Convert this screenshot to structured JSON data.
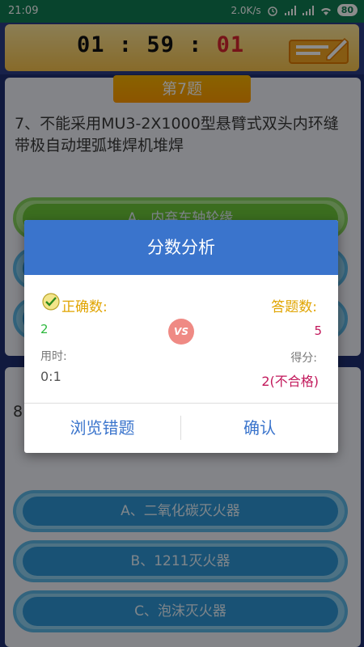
{
  "status_bar": {
    "time": "21:09",
    "speed": "2.0K/s",
    "battery": "80",
    "icons": [
      "alarm-icon",
      "signal-icon",
      "signal-icon",
      "wifi-icon",
      "battery-icon"
    ]
  },
  "timer": {
    "hours": "01",
    "sep1": ":",
    "minutes": "59",
    "sep2": ":",
    "seconds": "01"
  },
  "question1": {
    "tab": "第7题",
    "text": "7、不能采用MU3-2X1000型悬臂式双头内环缝带极自动埋弧堆焊机堆焊",
    "option_a": "A、内弃车轴轮缘"
  },
  "question2": {
    "number": "8",
    "options": [
      "A、二氧化碳灭火器",
      "B、1211灭火器",
      "C、泡沫灭火器"
    ]
  },
  "dialog": {
    "title": "分数分析",
    "correct_label": "正确数:",
    "correct_value": "2",
    "vs": "VS",
    "total_label": "答题数:",
    "total_value": "5",
    "time_label": "用时:",
    "time_value": "0:1",
    "score_label": "得分:",
    "score_value": "2(不合格)",
    "browse_button": "浏览错题",
    "confirm_button": "确认"
  },
  "colors": {
    "dialog_header": "#3a74cc",
    "label_gold": "#e0a400",
    "correct_green": "#2db83d",
    "score_red": "#c2185b"
  }
}
